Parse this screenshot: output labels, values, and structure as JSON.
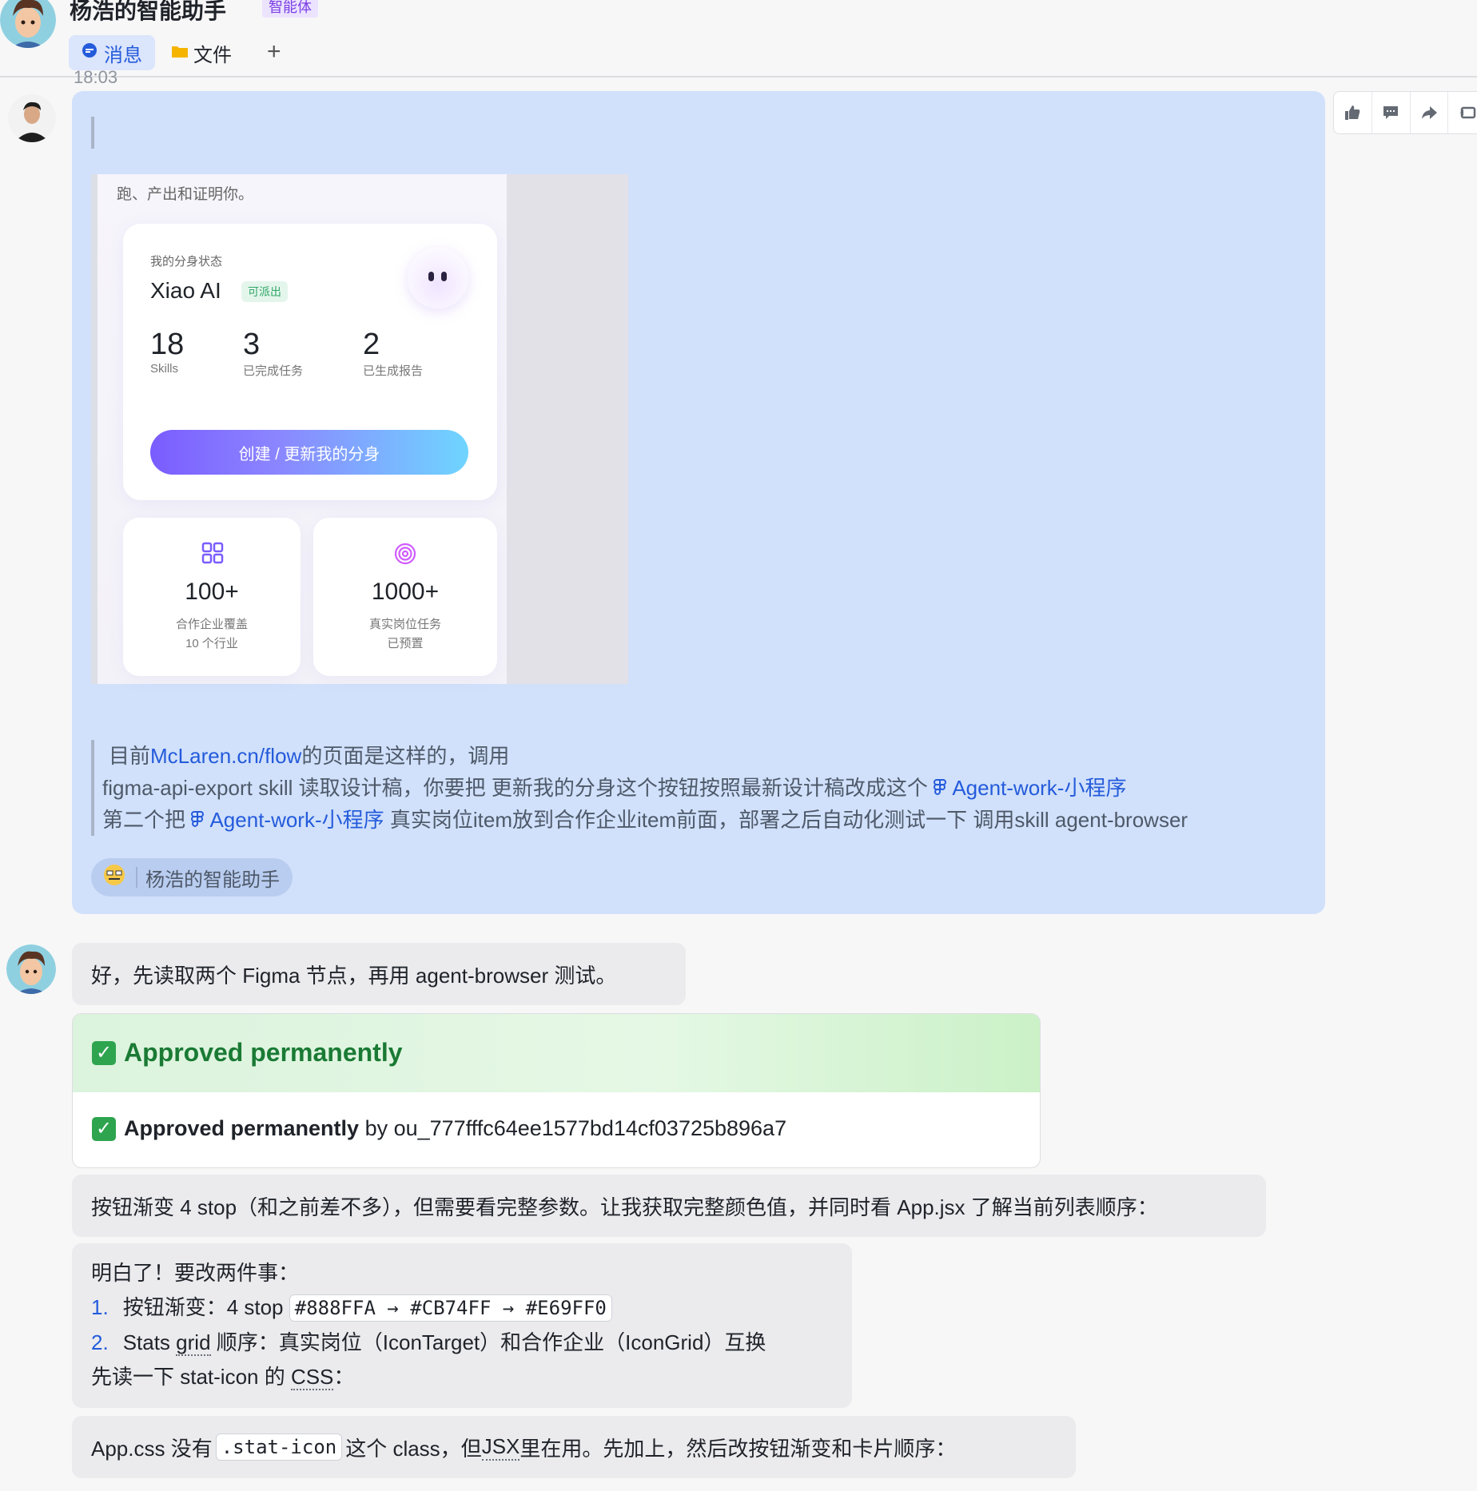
{
  "header": {
    "title": "杨浩的智能助手",
    "badge": "智能体",
    "tabs": [
      {
        "label": "消息",
        "icon": "chat-bubble-icon"
      },
      {
        "label": "文件",
        "icon": "folder-icon"
      }
    ],
    "add_tab": "+"
  },
  "message1": {
    "time": "18:03",
    "screenshot": {
      "subtitle": "跑、产出和证明你。",
      "status_label": "我的分身状态",
      "agent_name": "Xiao AI",
      "status_pill": "可派出",
      "stats": [
        {
          "value": "18",
          "label": "Skills"
        },
        {
          "value": "3",
          "label": "已完成任务"
        },
        {
          "value": "2",
          "label": "已生成报告"
        }
      ],
      "cta": "创建 / 更新我的分身",
      "cards": [
        {
          "value": "100+",
          "line1": "合作企业覆盖",
          "line2": "10 个行业",
          "icon": "grid-icon"
        },
        {
          "value": "1000+",
          "line1": "真实岗位任务",
          "line2": "已预置",
          "icon": "target-icon"
        }
      ]
    },
    "instruction": {
      "p1_prefix": "目前",
      "p1_link": "McLaren.cn/flow",
      "p1_suffix": "的页面是这样的，调用",
      "p2_prefix": "figma-api-export skill  读取设计稿，你要把 更新我的分身这个按钮按照最新设计稿改成这个 ",
      "figma_link": "Agent-work-小程序",
      "p3_prefix": "第二个把 ",
      "p3_suffix": " 真实岗位item放到合作企业item前面，部署之后自动化测试一下 调用skill agent-browser"
    },
    "mention": "杨浩的智能助手"
  },
  "message2": {
    "text": "好，先读取两个 Figma 节点，再用 agent-browser 测试。"
  },
  "approval": {
    "title": "Approved permanently",
    "body_bold": "Approved permanently",
    "body_rest": "by ou_777fffc64ee1577bd14cf03725b896a7"
  },
  "message3": {
    "text": "按钮渐变 4 stop（和之前差不多），但需要看完整参数。让我获取完整颜色值，并同时看 App.jsx 了解当前列表顺序："
  },
  "message4": {
    "intro": "明白了！要改两件事：",
    "item1_num": "1.",
    "item1_text": "按钮渐变：4 stop ",
    "item1_code": "#888FFA → #CB74FF → #E69FF0",
    "item2_num": "2.",
    "item2_pre": "Stats ",
    "item2_grid": "grid",
    "item2_post": " 顺序：真实岗位（IconTarget）和合作企业（IconGrid）互换",
    "outro_pre": "先读一下 stat-icon 的 ",
    "outro_css": "CSS",
    "outro_post": "："
  },
  "message5": {
    "pre": "App.css 没有 ",
    "code": ".stat-icon",
    "mid": " 这个 class，但 ",
    "jsx": "JSX",
    "post": " 里在用。先加上，然后改按钮渐变和卡片顺序："
  },
  "colors": {
    "bubble_blue": "#d1e1fb",
    "bubble_gray": "#ebebee",
    "link": "#245bdb",
    "approve_green": "#1a7a34"
  }
}
